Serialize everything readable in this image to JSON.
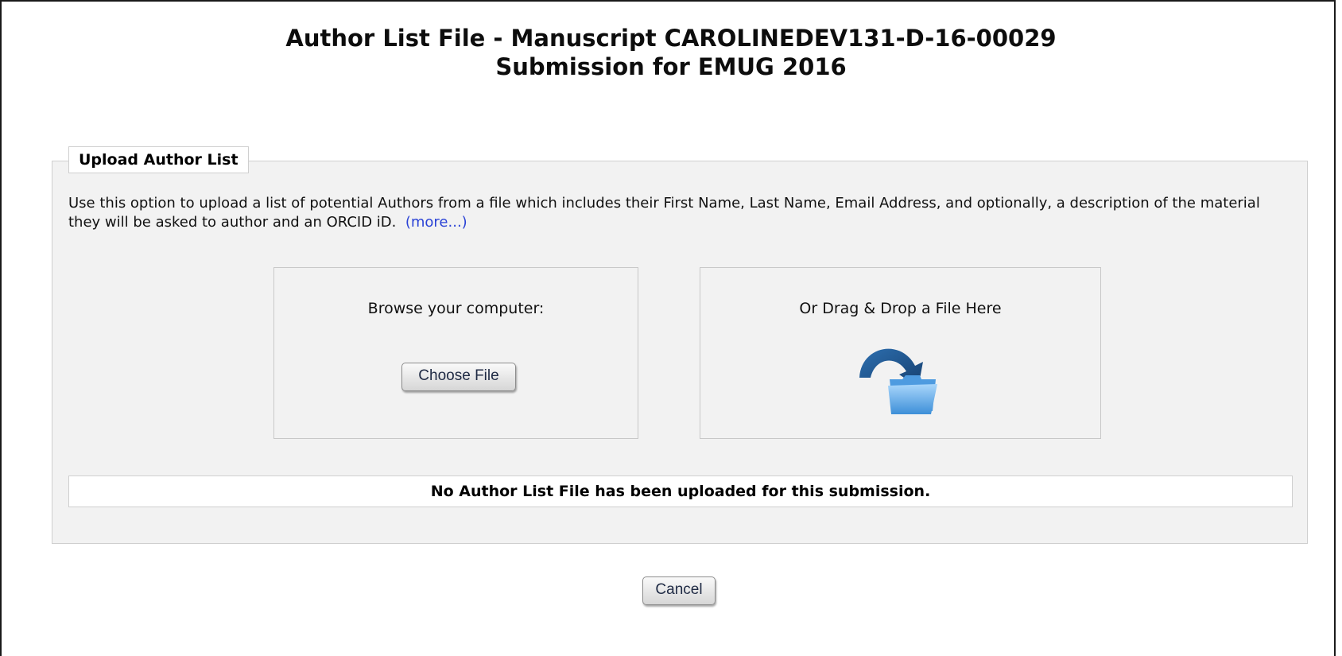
{
  "header": {
    "title_line1": "Author List File - Manuscript CAROLINEDEV131-D-16-00029",
    "title_line2": "Submission for EMUG 2016"
  },
  "upload_panel": {
    "legend": "Upload Author List",
    "description": "Use this option to upload a list of potential Authors from a file which includes their First Name, Last Name, Email Address, and optionally, a description of the material they will be asked to author and an ORCID iD.",
    "more_link": "(more...)",
    "browse": {
      "label": "Browse your computer:",
      "button": "Choose File"
    },
    "drop": {
      "label": "Or Drag & Drop a File Here",
      "icon": "folder-drop-icon"
    },
    "status": "No Author List File has been uploaded for this submission."
  },
  "footer": {
    "cancel_button": "Cancel"
  },
  "colors": {
    "link": "#2b43d6",
    "panel_bg": "#f2f2f2",
    "icon_arrow": "#1f5f9e",
    "icon_folder": "#5aa8e8"
  }
}
